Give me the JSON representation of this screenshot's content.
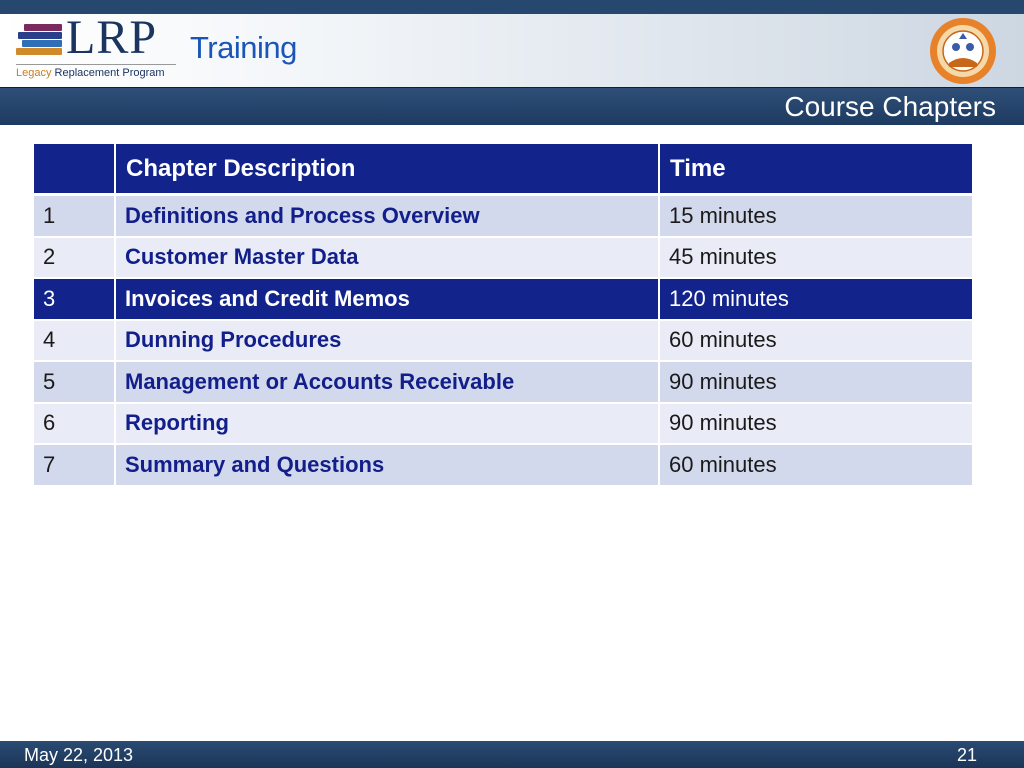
{
  "header": {
    "logo_mark": "LRP",
    "logo_sub_accent": "Legacy",
    "logo_sub_rest": " Replacement Program",
    "section": "Training",
    "seal_label": "Los Angeles Unified School District seal"
  },
  "slide": {
    "title": "Course Chapters"
  },
  "table": {
    "columns": [
      "",
      "Chapter Description",
      "Time"
    ],
    "rows": [
      {
        "num": "1",
        "desc": "Definitions and Process Overview",
        "time": "15 minutes"
      },
      {
        "num": "2",
        "desc": "Customer Master Data",
        "time": "45 minutes"
      },
      {
        "num": "3",
        "desc": "Invoices and Credit Memos",
        "time": "120 minutes"
      },
      {
        "num": "4",
        "desc": "Dunning Procedures",
        "time": "60 minutes"
      },
      {
        "num": "5",
        "desc": "Management or Accounts Receivable",
        "time": "90 minutes"
      },
      {
        "num": "6",
        "desc": "Reporting",
        "time": "90 minutes"
      },
      {
        "num": "7",
        "desc": "Summary and Questions",
        "time": "60 minutes"
      }
    ],
    "highlighted_row": "3"
  },
  "footer": {
    "date": "May 22, 2013",
    "page": "21"
  },
  "colors": {
    "navy": "#12238c",
    "header_bar": "#1e3b61",
    "row_odd": "#d3d9ec",
    "row_even": "#e9ecf6",
    "accent_orange": "#c77f20",
    "training_blue": "#1a56b8"
  }
}
